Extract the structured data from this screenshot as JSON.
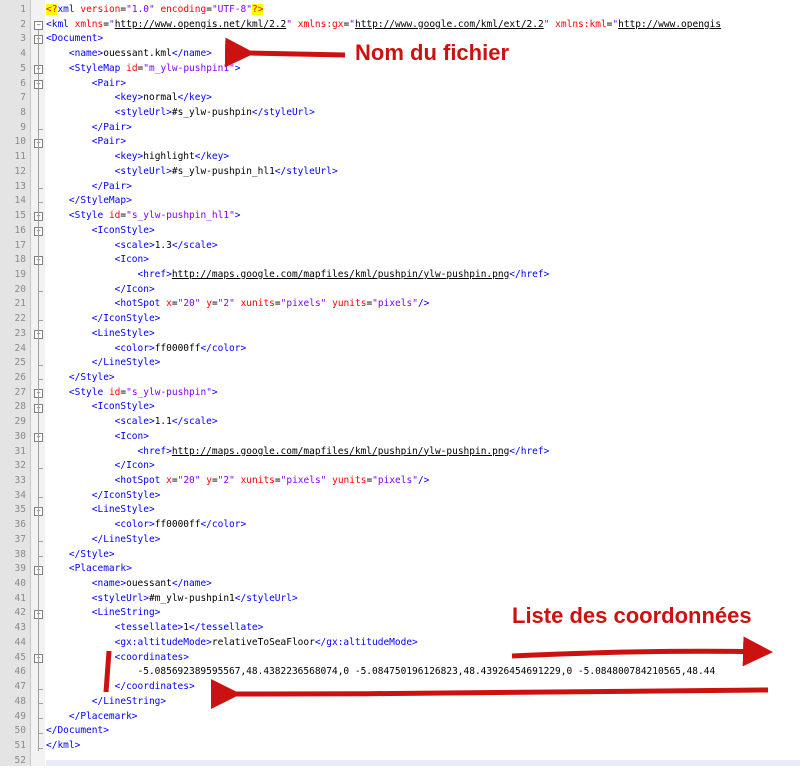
{
  "editor": {
    "lines": [
      {
        "n": "1",
        "segs": [
          {
            "k": "pi",
            "t": "<?"
          },
          {
            "k": "t",
            "t": "xml "
          },
          {
            "k": "a",
            "t": "version"
          },
          {
            "k": "c",
            "t": "="
          },
          {
            "k": "v",
            "t": "\"1.0\""
          },
          {
            "k": "a",
            "t": " encoding"
          },
          {
            "k": "c",
            "t": "="
          },
          {
            "k": "v",
            "t": "\"UTF-8\""
          },
          {
            "k": "pi",
            "t": "?>"
          }
        ]
      },
      {
        "n": "2",
        "segs": [
          {
            "k": "t",
            "t": "<kml "
          },
          {
            "k": "a",
            "t": "xmlns"
          },
          {
            "k": "c",
            "t": "="
          },
          {
            "k": "v",
            "t": "\""
          },
          {
            "k": "u",
            "t": "http://www.opengis.net/kml/2.2"
          },
          {
            "k": "v",
            "t": "\""
          },
          {
            "k": "a",
            "t": " xmlns:gx"
          },
          {
            "k": "c",
            "t": "="
          },
          {
            "k": "v",
            "t": "\""
          },
          {
            "k": "u",
            "t": "http://www.google.com/kml/ext/2.2"
          },
          {
            "k": "v",
            "t": "\""
          },
          {
            "k": "a",
            "t": " xmlns:kml"
          },
          {
            "k": "c",
            "t": "="
          },
          {
            "k": "v",
            "t": "\""
          },
          {
            "k": "u",
            "t": "http://www.opengis"
          }
        ]
      },
      {
        "n": "3",
        "segs": [
          {
            "k": "t",
            "t": "<Document>"
          }
        ]
      },
      {
        "n": "4",
        "segs": [
          {
            "k": "c",
            "t": "    "
          },
          {
            "k": "t",
            "t": "<name>"
          },
          {
            "k": "c",
            "t": "ouessant.kml"
          },
          {
            "k": "t",
            "t": "</name>"
          }
        ]
      },
      {
        "n": "5",
        "segs": [
          {
            "k": "c",
            "t": "    "
          },
          {
            "k": "t",
            "t": "<StyleMap "
          },
          {
            "k": "a",
            "t": "id"
          },
          {
            "k": "c",
            "t": "="
          },
          {
            "k": "v",
            "t": "\"m_ylw-pushpin1\""
          },
          {
            "k": "t",
            "t": ">"
          }
        ]
      },
      {
        "n": "6",
        "segs": [
          {
            "k": "c",
            "t": "        "
          },
          {
            "k": "t",
            "t": "<Pair>"
          }
        ]
      },
      {
        "n": "7",
        "segs": [
          {
            "k": "c",
            "t": "            "
          },
          {
            "k": "t",
            "t": "<key>"
          },
          {
            "k": "c",
            "t": "normal"
          },
          {
            "k": "t",
            "t": "</key>"
          }
        ]
      },
      {
        "n": "8",
        "segs": [
          {
            "k": "c",
            "t": "            "
          },
          {
            "k": "t",
            "t": "<styleUrl>"
          },
          {
            "k": "c",
            "t": "#s_ylw-pushpin"
          },
          {
            "k": "t",
            "t": "</styleUrl>"
          }
        ]
      },
      {
        "n": "9",
        "segs": [
          {
            "k": "c",
            "t": "        "
          },
          {
            "k": "t",
            "t": "</Pair>"
          }
        ]
      },
      {
        "n": "10",
        "segs": [
          {
            "k": "c",
            "t": "        "
          },
          {
            "k": "t",
            "t": "<Pair>"
          }
        ]
      },
      {
        "n": "11",
        "segs": [
          {
            "k": "c",
            "t": "            "
          },
          {
            "k": "t",
            "t": "<key>"
          },
          {
            "k": "c",
            "t": "highlight"
          },
          {
            "k": "t",
            "t": "</key>"
          }
        ]
      },
      {
        "n": "12",
        "segs": [
          {
            "k": "c",
            "t": "            "
          },
          {
            "k": "t",
            "t": "<styleUrl>"
          },
          {
            "k": "c",
            "t": "#s_ylw-pushpin_hl1"
          },
          {
            "k": "t",
            "t": "</styleUrl>"
          }
        ]
      },
      {
        "n": "13",
        "segs": [
          {
            "k": "c",
            "t": "        "
          },
          {
            "k": "t",
            "t": "</Pair>"
          }
        ]
      },
      {
        "n": "14",
        "segs": [
          {
            "k": "c",
            "t": "    "
          },
          {
            "k": "t",
            "t": "</StyleMap>"
          }
        ]
      },
      {
        "n": "15",
        "segs": [
          {
            "k": "c",
            "t": "    "
          },
          {
            "k": "t",
            "t": "<Style "
          },
          {
            "k": "a",
            "t": "id"
          },
          {
            "k": "c",
            "t": "="
          },
          {
            "k": "v",
            "t": "\"s_ylw-pushpin_hl1\""
          },
          {
            "k": "t",
            "t": ">"
          }
        ]
      },
      {
        "n": "16",
        "segs": [
          {
            "k": "c",
            "t": "        "
          },
          {
            "k": "t",
            "t": "<IconStyle>"
          }
        ]
      },
      {
        "n": "17",
        "segs": [
          {
            "k": "c",
            "t": "            "
          },
          {
            "k": "t",
            "t": "<scale>"
          },
          {
            "k": "c",
            "t": "1.3"
          },
          {
            "k": "t",
            "t": "</scale>"
          }
        ]
      },
      {
        "n": "18",
        "segs": [
          {
            "k": "c",
            "t": "            "
          },
          {
            "k": "t",
            "t": "<Icon>"
          }
        ]
      },
      {
        "n": "19",
        "segs": [
          {
            "k": "c",
            "t": "                "
          },
          {
            "k": "t",
            "t": "<href>"
          },
          {
            "k": "u",
            "t": "http://maps.google.com/mapfiles/kml/pushpin/ylw-pushpin.png"
          },
          {
            "k": "t",
            "t": "</href>"
          }
        ]
      },
      {
        "n": "20",
        "segs": [
          {
            "k": "c",
            "t": "            "
          },
          {
            "k": "t",
            "t": "</Icon>"
          }
        ]
      },
      {
        "n": "21",
        "segs": [
          {
            "k": "c",
            "t": "            "
          },
          {
            "k": "t",
            "t": "<hotSpot "
          },
          {
            "k": "a",
            "t": "x"
          },
          {
            "k": "c",
            "t": "="
          },
          {
            "k": "v",
            "t": "\"20\""
          },
          {
            "k": "a",
            "t": " y"
          },
          {
            "k": "c",
            "t": "="
          },
          {
            "k": "v",
            "t": "\"2\""
          },
          {
            "k": "a",
            "t": " xunits"
          },
          {
            "k": "c",
            "t": "="
          },
          {
            "k": "v",
            "t": "\"pixels\""
          },
          {
            "k": "a",
            "t": " yunits"
          },
          {
            "k": "c",
            "t": "="
          },
          {
            "k": "v",
            "t": "\"pixels\""
          },
          {
            "k": "t",
            "t": "/>"
          }
        ]
      },
      {
        "n": "22",
        "segs": [
          {
            "k": "c",
            "t": "        "
          },
          {
            "k": "t",
            "t": "</IconStyle>"
          }
        ]
      },
      {
        "n": "23",
        "segs": [
          {
            "k": "c",
            "t": "        "
          },
          {
            "k": "t",
            "t": "<LineStyle>"
          }
        ]
      },
      {
        "n": "24",
        "segs": [
          {
            "k": "c",
            "t": "            "
          },
          {
            "k": "t",
            "t": "<color>"
          },
          {
            "k": "c",
            "t": "ff0000ff"
          },
          {
            "k": "t",
            "t": "</color>"
          }
        ]
      },
      {
        "n": "25",
        "segs": [
          {
            "k": "c",
            "t": "        "
          },
          {
            "k": "t",
            "t": "</LineStyle>"
          }
        ]
      },
      {
        "n": "26",
        "segs": [
          {
            "k": "c",
            "t": "    "
          },
          {
            "k": "t",
            "t": "</Style>"
          }
        ]
      },
      {
        "n": "27",
        "segs": [
          {
            "k": "c",
            "t": "    "
          },
          {
            "k": "t",
            "t": "<Style "
          },
          {
            "k": "a",
            "t": "id"
          },
          {
            "k": "c",
            "t": "="
          },
          {
            "k": "v",
            "t": "\"s_ylw-pushpin\""
          },
          {
            "k": "t",
            "t": ">"
          }
        ]
      },
      {
        "n": "28",
        "segs": [
          {
            "k": "c",
            "t": "        "
          },
          {
            "k": "t",
            "t": "<IconStyle>"
          }
        ]
      },
      {
        "n": "29",
        "segs": [
          {
            "k": "c",
            "t": "            "
          },
          {
            "k": "t",
            "t": "<scale>"
          },
          {
            "k": "c",
            "t": "1.1"
          },
          {
            "k": "t",
            "t": "</scale>"
          }
        ]
      },
      {
        "n": "30",
        "segs": [
          {
            "k": "c",
            "t": "            "
          },
          {
            "k": "t",
            "t": "<Icon>"
          }
        ]
      },
      {
        "n": "31",
        "segs": [
          {
            "k": "c",
            "t": "                "
          },
          {
            "k": "t",
            "t": "<href>"
          },
          {
            "k": "u",
            "t": "http://maps.google.com/mapfiles/kml/pushpin/ylw-pushpin.png"
          },
          {
            "k": "t",
            "t": "</href>"
          }
        ]
      },
      {
        "n": "32",
        "segs": [
          {
            "k": "c",
            "t": "            "
          },
          {
            "k": "t",
            "t": "</Icon>"
          }
        ]
      },
      {
        "n": "33",
        "segs": [
          {
            "k": "c",
            "t": "            "
          },
          {
            "k": "t",
            "t": "<hotSpot "
          },
          {
            "k": "a",
            "t": "x"
          },
          {
            "k": "c",
            "t": "="
          },
          {
            "k": "v",
            "t": "\"20\""
          },
          {
            "k": "a",
            "t": " y"
          },
          {
            "k": "c",
            "t": "="
          },
          {
            "k": "v",
            "t": "\"2\""
          },
          {
            "k": "a",
            "t": " xunits"
          },
          {
            "k": "c",
            "t": "="
          },
          {
            "k": "v",
            "t": "\"pixels\""
          },
          {
            "k": "a",
            "t": " yunits"
          },
          {
            "k": "c",
            "t": "="
          },
          {
            "k": "v",
            "t": "\"pixels\""
          },
          {
            "k": "t",
            "t": "/>"
          }
        ]
      },
      {
        "n": "34",
        "segs": [
          {
            "k": "c",
            "t": "        "
          },
          {
            "k": "t",
            "t": "</IconStyle>"
          }
        ]
      },
      {
        "n": "35",
        "segs": [
          {
            "k": "c",
            "t": "        "
          },
          {
            "k": "t",
            "t": "<LineStyle>"
          }
        ]
      },
      {
        "n": "36",
        "segs": [
          {
            "k": "c",
            "t": "            "
          },
          {
            "k": "t",
            "t": "<color>"
          },
          {
            "k": "c",
            "t": "ff0000ff"
          },
          {
            "k": "t",
            "t": "</color>"
          }
        ]
      },
      {
        "n": "37",
        "segs": [
          {
            "k": "c",
            "t": "        "
          },
          {
            "k": "t",
            "t": "</LineStyle>"
          }
        ]
      },
      {
        "n": "38",
        "segs": [
          {
            "k": "c",
            "t": "    "
          },
          {
            "k": "t",
            "t": "</Style>"
          }
        ]
      },
      {
        "n": "39",
        "segs": [
          {
            "k": "c",
            "t": "    "
          },
          {
            "k": "t",
            "t": "<Placemark>"
          }
        ]
      },
      {
        "n": "40",
        "segs": [
          {
            "k": "c",
            "t": "        "
          },
          {
            "k": "t",
            "t": "<name>"
          },
          {
            "k": "c",
            "t": "ouessant"
          },
          {
            "k": "t",
            "t": "</name>"
          }
        ]
      },
      {
        "n": "41",
        "segs": [
          {
            "k": "c",
            "t": "        "
          },
          {
            "k": "t",
            "t": "<styleUrl>"
          },
          {
            "k": "c",
            "t": "#m_ylw-pushpin1"
          },
          {
            "k": "t",
            "t": "</styleUrl>"
          }
        ]
      },
      {
        "n": "42",
        "segs": [
          {
            "k": "c",
            "t": "        "
          },
          {
            "k": "t",
            "t": "<LineString>"
          }
        ]
      },
      {
        "n": "43",
        "segs": [
          {
            "k": "c",
            "t": "            "
          },
          {
            "k": "t",
            "t": "<tessellate>"
          },
          {
            "k": "c",
            "t": "1"
          },
          {
            "k": "t",
            "t": "</tessellate>"
          }
        ]
      },
      {
        "n": "44",
        "segs": [
          {
            "k": "c",
            "t": "            "
          },
          {
            "k": "t",
            "t": "<gx:altitudeMode>"
          },
          {
            "k": "c",
            "t": "relativeToSeaFloor"
          },
          {
            "k": "t",
            "t": "</gx:altitudeMode>"
          }
        ]
      },
      {
        "n": "45",
        "segs": [
          {
            "k": "c",
            "t": "            "
          },
          {
            "k": "t",
            "t": "<coordinates>"
          }
        ]
      },
      {
        "n": "46",
        "segs": [
          {
            "k": "c",
            "t": "                -5.085692389595567,48.4382236568074,0 -5.084750196126823,48.43926454691229,0 -5.084800784210565,48.44"
          }
        ]
      },
      {
        "n": "47",
        "segs": [
          {
            "k": "c",
            "t": "            "
          },
          {
            "k": "t",
            "t": "</coordinates>"
          }
        ]
      },
      {
        "n": "48",
        "segs": [
          {
            "k": "c",
            "t": "        "
          },
          {
            "k": "t",
            "t": "</LineString>"
          }
        ]
      },
      {
        "n": "49",
        "segs": [
          {
            "k": "c",
            "t": "    "
          },
          {
            "k": "t",
            "t": "</Placemark>"
          }
        ]
      },
      {
        "n": "50",
        "segs": [
          {
            "k": "t",
            "t": "</Document>"
          }
        ]
      },
      {
        "n": "51",
        "segs": [
          {
            "k": "t",
            "t": "</kml>"
          }
        ]
      },
      {
        "n": "52",
        "segs": []
      }
    ]
  },
  "annotations": {
    "file_name_label": "Nom du fichier",
    "coords_label": "Liste des coordonnées"
  },
  "colors": {
    "tag": "#0000ff",
    "attribute": "#ff0000",
    "value": "#8000ff",
    "annotation": "#cc1111",
    "pi_highlight": "#ffff00"
  }
}
